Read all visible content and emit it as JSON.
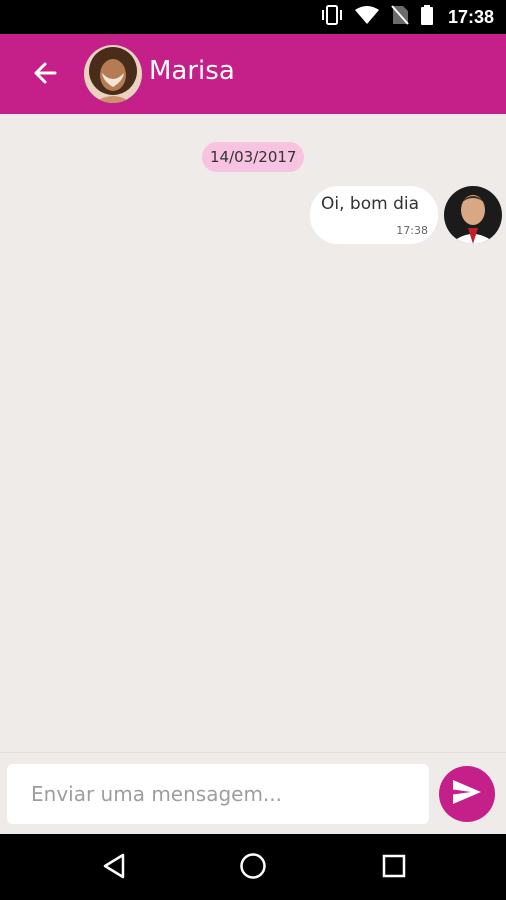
{
  "status_bar": {
    "time": "17:38",
    "icons": [
      "vibrate-icon",
      "wifi-icon",
      "no-sim-icon",
      "battery-icon"
    ]
  },
  "header": {
    "contact_name": "Marisa",
    "back_icon": "arrow-back-icon",
    "avatar": "contact-photo",
    "color": "#c51f89"
  },
  "chat": {
    "date_label": "14/03/2017",
    "messages": [
      {
        "text": "Oi, bom dia",
        "time": "17:38",
        "sender_avatar": "doctor-photo"
      }
    ]
  },
  "composer": {
    "placeholder": "Enviar uma mensagem...",
    "value": "",
    "send_icon": "send-icon"
  },
  "nav_bar": {
    "buttons": [
      "back-triangle-icon",
      "home-circle-icon",
      "recents-square-icon"
    ]
  },
  "colors": {
    "accent": "#c51f89",
    "date_chip": "#f7c3e0",
    "chat_background": "#efebe8"
  }
}
